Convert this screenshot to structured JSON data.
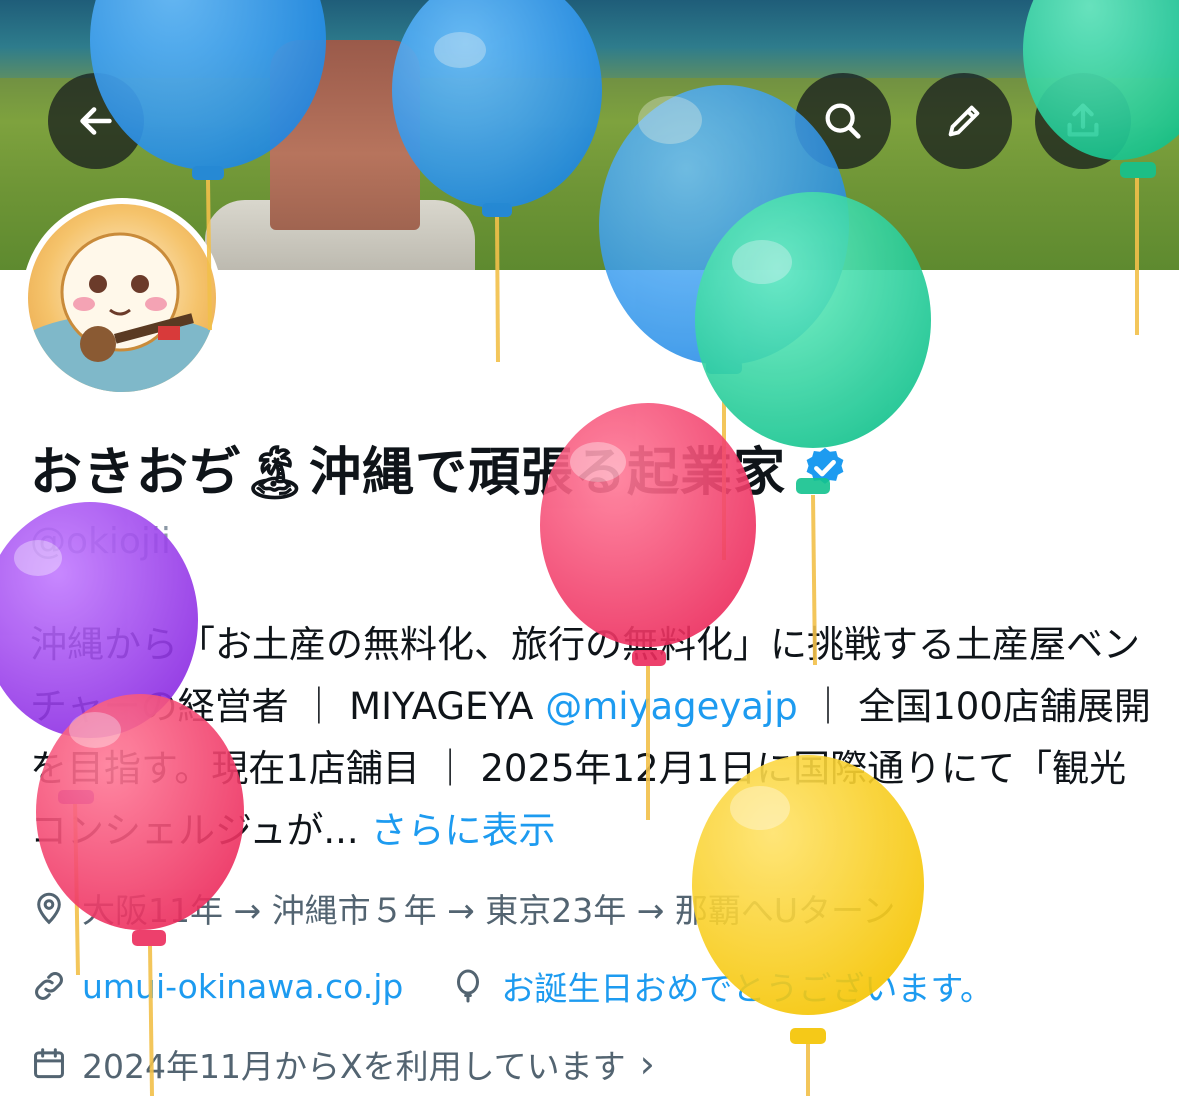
{
  "header": {
    "back_icon": "back-arrow-icon",
    "search_icon": "search-icon",
    "edit_icon": "pencil-icon",
    "share_icon": "share-icon"
  },
  "profile": {
    "name": "おきおぢ🏝沖縄で頑張る起業家",
    "verified": true,
    "handle": "@okiojii",
    "bio_prefix": "沖縄から「お土産の無料化、旅行の無料化」に挑戦する土産屋ベンチャーの経営者 ｜ MIYAGEYA ",
    "bio_mention": "@miyageyajp",
    "bio_suffix": " ｜ 全国100店舗展開を目指す。現在1店舗目 ｜ 2025年12月1日に国際通りにて「観光コンシェルジュが...  ",
    "bio_more": "さらに表示",
    "location": "大阪11年 → 沖縄市５年 → 東京23年 → 那覇へUターン",
    "website": "umui-okinawa.co.jp",
    "birthday": "お誕生日おめでとうございます。",
    "joined": "2024年11月からXを利用しています",
    "joined_chevron": "›"
  },
  "colors": {
    "accent": "#1d9bf0",
    "text": "#0f1419",
    "muted": "#536471",
    "handle": "#8b98a5",
    "verified": "#1d9bf0"
  }
}
